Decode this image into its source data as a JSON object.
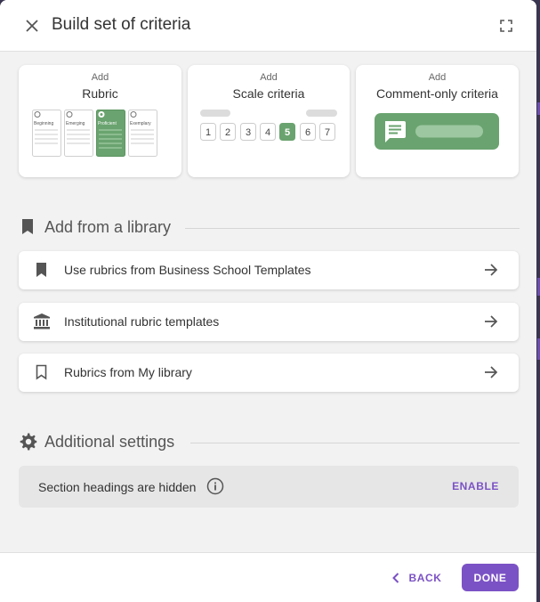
{
  "header": {
    "title": "Build set of criteria",
    "close_icon": "close-icon",
    "fullscreen_icon": "fullscreen-icon"
  },
  "cards": [
    {
      "add_label": "Add",
      "name": "Rubric",
      "levels": [
        "Beginning",
        "Emerging",
        "Proficient",
        "Exemplary"
      ],
      "selected_level": "Proficient"
    },
    {
      "add_label": "Add",
      "name": "Scale criteria",
      "scale": [
        "1",
        "2",
        "3",
        "4",
        "5",
        "6",
        "7"
      ],
      "selected": "5"
    },
    {
      "add_label": "Add",
      "name": "Comment-only criteria",
      "icon": "comment-icon"
    }
  ],
  "library": {
    "title": "Add from a library",
    "icon": "bookmark-icon",
    "items": [
      {
        "label": "Use rubrics from Business School Templates",
        "icon": "bookmark-filled-icon"
      },
      {
        "label": "Institutional rubric templates",
        "icon": "institution-icon"
      },
      {
        "label": "Rubrics from My library",
        "icon": "bookmark-outline-icon"
      }
    ]
  },
  "settings": {
    "title": "Additional settings",
    "icon": "gear-icon",
    "section_headings_label": "Section headings are hidden",
    "enable_label": "ENABLE"
  },
  "footer": {
    "back_label": "BACK",
    "done_label": "DONE"
  },
  "colors": {
    "accent": "#7b52c5",
    "green": "#6aa36f"
  }
}
